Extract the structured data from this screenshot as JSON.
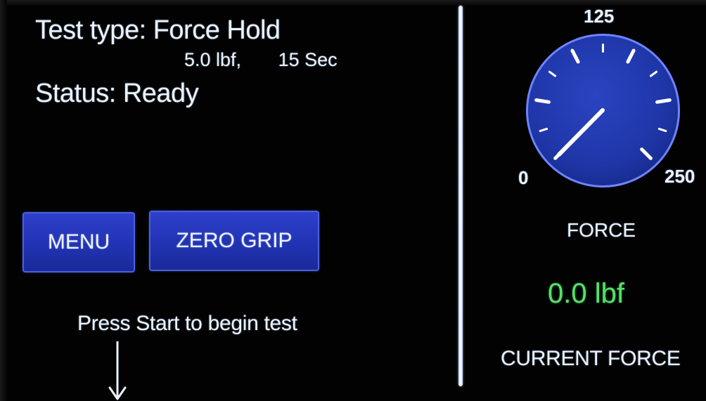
{
  "test": {
    "type_text": "Test type: Force Hold",
    "params_text": "5.0 lbf,       15 Sec",
    "status_text": "Status: Ready"
  },
  "buttons": {
    "menu_label": "MENU",
    "zero_grip_label": "ZERO GRIP"
  },
  "prompt": {
    "text": "Press Start to begin test"
  },
  "gauge": {
    "min_label": "0",
    "mid_label": "125",
    "max_label": "250",
    "value": 0.0,
    "face_color": "#1f36a8",
    "rim_color": "#6e84ff",
    "needle_color": "#ffffff"
  },
  "readout": {
    "force_label": "FORCE",
    "value_text": "0.0 lbf",
    "value_color": "#55e26a",
    "caption": "CURRENT FORCE"
  },
  "icons": {
    "prompt_arrow": "arrow-down-icon"
  }
}
